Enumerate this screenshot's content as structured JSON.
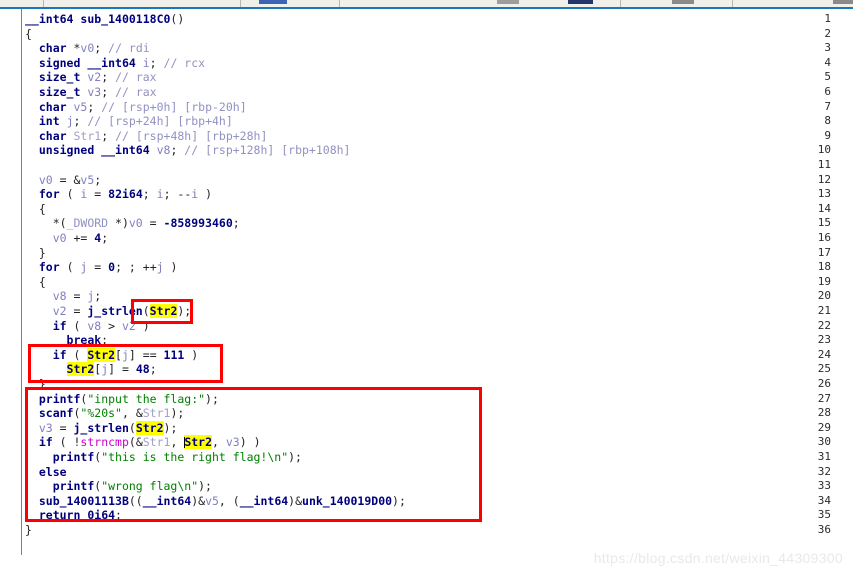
{
  "window": {
    "app": "IDA Pro Hex-Rays Decompiler",
    "toolbar_visible_fragment": true
  },
  "watermark": "https://blog.csdn.net/weixin_44309300",
  "editor": {
    "language": "C (decompiled pseudocode)",
    "function_signature": "__int64 sub_1400118C0()",
    "highlight_token": "Str2",
    "highlight_color": "#ffff00",
    "annotation_color": "#ff0000",
    "first_line": 1,
    "last_line": 36,
    "line_numbers": [
      1,
      2,
      3,
      4,
      5,
      6,
      7,
      8,
      9,
      10,
      11,
      12,
      13,
      14,
      15,
      16,
      17,
      18,
      19,
      20,
      21,
      22,
      23,
      24,
      25,
      26,
      27,
      28,
      29,
      30,
      31,
      32,
      33,
      34,
      35,
      36
    ],
    "lines": [
      "__int64 sub_1400118C0()",
      "{",
      "  char *v0; // rdi",
      "  signed __int64 i; // rcx",
      "  size_t v2; // rax",
      "  size_t v3; // rax",
      "  char v5; // [rsp+0h] [rbp-20h]",
      "  int j; // [rsp+24h] [rbp+4h]",
      "  char Str1; // [rsp+48h] [rbp+28h]",
      "  unsigned __int64 v8; // [rsp+128h] [rbp+108h]",
      "",
      "  v0 = &v5;",
      "  for ( i = 82i64; i; --i )",
      "  {",
      "    *(_DWORD *)v0 = -858993460;",
      "    v0 += 4;",
      "  }",
      "  for ( j = 0; ; ++j )",
      "  {",
      "    v8 = j;",
      "    v2 = j_strlen(Str2);",
      "    if ( v8 > v2 )",
      "      break;",
      "    if ( Str2[j] == 111 )",
      "      Str2[j] = 48;",
      "  }",
      "  printf(\"input the flag:\");",
      "  scanf(\"%20s\", &Str1);",
      "  v3 = j_strlen(Str2);",
      "  if ( !strncmp(&Str1, Str2, v3) )",
      "    printf(\"this is the right flag!\\n\");",
      "  else",
      "    printf(\"wrong flag\\n\");",
      "  sub_14001113B((__int64)&v5, (__int64)&unk_140019D00);",
      "  return 0i64;",
      "}"
    ]
  },
  "annotations": [
    {
      "name": "strlen-str2-box",
      "label": "j_strlen(Str2) call boxed"
    },
    {
      "name": "char-replace-box",
      "label": "if ( Str2[j] == 111 ) Str2[j] = 48;"
    },
    {
      "name": "flag-compare-box",
      "label": "printf/scanf/strncmp flag check block"
    }
  ],
  "colors": {
    "keyword": "#00007f",
    "string": "#008000",
    "comment": "#9191c2",
    "variable": "#8080c0",
    "library_call": "#cc00cc",
    "highlight_bg": "#ffff00",
    "annotation": "#ff0000",
    "gutter_rule": "#5b87c6",
    "toolbar_accent": "#1a77bb"
  }
}
